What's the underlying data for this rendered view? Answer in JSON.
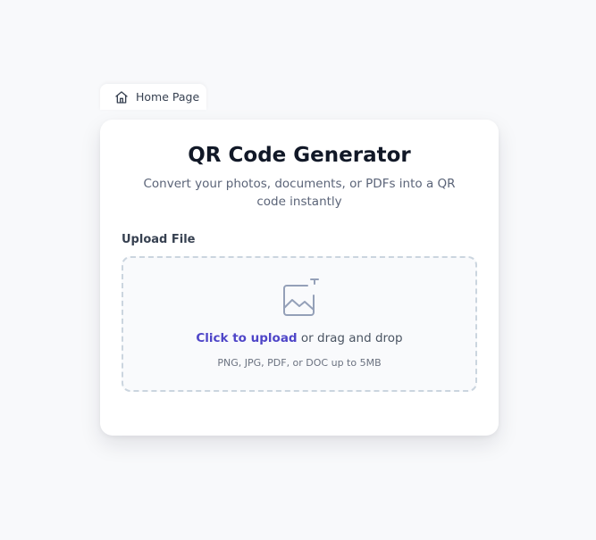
{
  "home_tab": {
    "label": "Home Page",
    "icon": "home-icon"
  },
  "card": {
    "title": "QR Code Generator",
    "subtitle": "Convert your photos, documents, or PDFs into a QR code instantly"
  },
  "upload": {
    "label": "Upload File",
    "icon": "image-upload-icon",
    "link_text": "Click to upload",
    "rest_text": " or drag and drop",
    "hint": "PNG, JPG, PDF, or DOC up to 5MB"
  },
  "colors": {
    "background": "#f8f9fb",
    "card": "#ffffff",
    "accent": "#4f46c8",
    "title": "#111827",
    "muted": "#5b6478",
    "dropzone_border": "#cbd5df"
  }
}
